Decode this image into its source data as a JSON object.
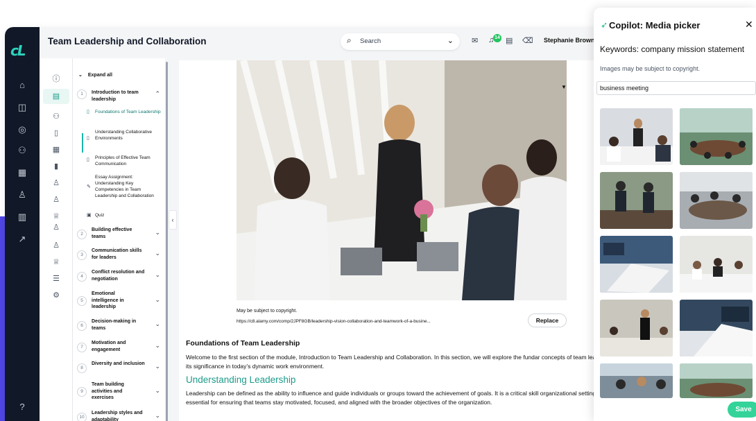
{
  "header": {
    "page_title": "Team Leadership and Collaboration",
    "search_label": "Search",
    "notification_count": "14",
    "user_name": "Stephanie Brown"
  },
  "outline": {
    "expand_all": "Expand all",
    "modules": [
      {
        "num": "1",
        "title": "Introduction to team leadership"
      },
      {
        "num": "2",
        "title": "Building effective teams"
      },
      {
        "num": "3",
        "title": "Communication skills for leaders"
      },
      {
        "num": "4",
        "title": "Conflict resolution and negotiation"
      },
      {
        "num": "5",
        "title": "Emotional intelligence in leadership"
      },
      {
        "num": "6",
        "title": "Decision-making in teams"
      },
      {
        "num": "7",
        "title": "Motivation and engagement"
      },
      {
        "num": "8",
        "title": "Diversity and inclusion"
      },
      {
        "num": "9",
        "title": "Team building activities and exercises"
      },
      {
        "num": "10",
        "title": "Leadership styles and adaptability"
      }
    ],
    "lessons": [
      {
        "title": "Foundations of Team Leadership"
      },
      {
        "title": "Understanding Collaborative Environments"
      },
      {
        "title": "Principles of Effective Team Communication"
      },
      {
        "title": "Essay Assignment: Understanding Key Competencies in Team Leadership and Collaboration"
      },
      {
        "title": "Quiz"
      }
    ]
  },
  "content": {
    "image_note": "May be subject to copyright.",
    "image_source": "https://c8.alamy.com/comp/2JPF8GB/leadership-vision-collaboration-and-teamwork-of-a-busine...",
    "replace_label": "Replace",
    "section_title": "Foundations of Team Leadership",
    "intro": "Welcome to the first section of the module, Introduction to Team Leadership and Collaboration. In this section, we will explore the fundar concepts of team leadership and its significance in today’s dynamic work environment.",
    "subheading": "Understanding Leadership",
    "body": "Leadership can be defined as the ability to influence and guide individuals or groups toward the achievement of goals. It is a critical skill organizational setting and is essential for ensuring that teams stay motivated, focused, and aligned with the broader objectives of the organization."
  },
  "copilot": {
    "title": "Copilot: Media picker",
    "keywords": "Keywords: company mission statement",
    "note": "Images may be subject to copyright.",
    "search_value": "business meeting",
    "save_label": "Save"
  },
  "colors": {
    "accent": "#1d9b8a",
    "rail": "#111827",
    "save": "#34d399",
    "side_band": "#4f46e5"
  }
}
